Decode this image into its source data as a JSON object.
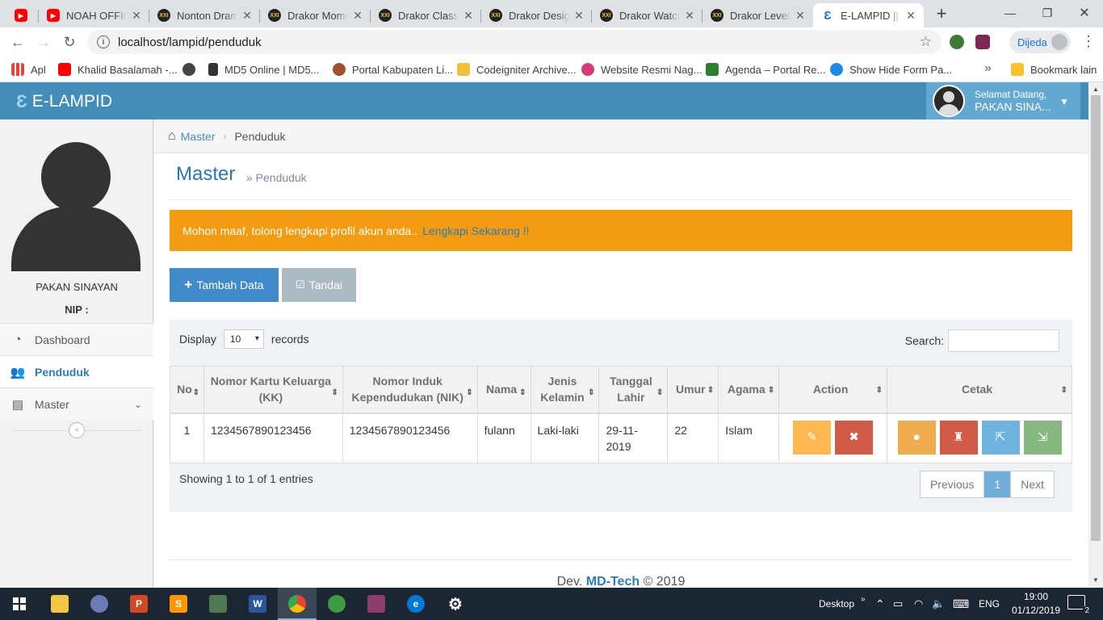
{
  "browser": {
    "tabs": [
      {
        "title": "",
        "icon": "youtube-icon"
      },
      {
        "title": "NOAH OFFICIAL",
        "icon": "youtube-icon"
      },
      {
        "title": "Nonton Drama",
        "icon": "drakor-icon"
      },
      {
        "title": "Drakor Moments",
        "icon": "drakor-icon"
      },
      {
        "title": "Drakor Class of",
        "icon": "drakor-icon"
      },
      {
        "title": "Drakor Design",
        "icon": "drakor-icon"
      },
      {
        "title": "Drakor Watch",
        "icon": "drakor-icon"
      },
      {
        "title": "Drakor Level Up",
        "icon": "drakor-icon"
      },
      {
        "title": "E-LAMPID || Ma",
        "icon": "elampid-icon"
      }
    ],
    "url": "localhost/lampid/penduduk",
    "profile_label": "Dijeda",
    "bookmarks": [
      {
        "label": "Apl"
      },
      {
        "label": "Khalid Basalamah -..."
      },
      {
        "label": ""
      },
      {
        "label": "MD5 Online | MD5..."
      },
      {
        "label": "Portal Kabupaten Li..."
      },
      {
        "label": "Codeigniter Archive..."
      },
      {
        "label": "Website Resmi Nag..."
      },
      {
        "label": "Agenda – Portal Re..."
      },
      {
        "label": "Show Hide Form Pa..."
      }
    ],
    "bookmarks_other": "Bookmark lain"
  },
  "app": {
    "brand": "E-LAMPID",
    "welcome": "Selamat Datang,",
    "user": "PAKAN SINA..."
  },
  "sidebar": {
    "name": "PAKAN SINAYAN",
    "nip": "NIP :",
    "items": [
      {
        "label": "Dashboard"
      },
      {
        "label": "Penduduk"
      },
      {
        "label": "Master"
      }
    ]
  },
  "breadcrumb": {
    "home": "Master",
    "current": "Penduduk"
  },
  "header": {
    "title": "Master",
    "subtitle": "» Penduduk"
  },
  "alert": {
    "text": "Mohon maaf, tolong lengkapi profil akun anda..",
    "link": "Lengkapi Sekarang !!"
  },
  "actions": {
    "add": "Tambah Data",
    "mark": "Tandai"
  },
  "table": {
    "display_label": "Display",
    "display_value": "10",
    "records_label": "records",
    "search_label": "Search:",
    "search_value": "",
    "columns": [
      "No",
      "Nomor Kartu Keluarga (KK)",
      "Nomor Induk Kependudukan (NIK)",
      "Nama",
      "Jenis Kelamin",
      "Tanggal Lahir",
      "Umur",
      "Agama",
      "Action",
      "Cetak"
    ],
    "rows": [
      {
        "no": "1",
        "kk": "1234567890123456",
        "nik": "1234567890123456",
        "nama": "fulann",
        "jk": "Laki-laki",
        "tgl": "29-11-2019",
        "umur": "22",
        "agama": "Islam"
      }
    ],
    "info": "Showing 1 to 1 of 1 entries",
    "prev": "Previous",
    "page": "1",
    "next": "Next"
  },
  "footer": {
    "prefix": "Dev.",
    "brand": "MD-Tech",
    "suffix": "© 2019"
  },
  "taskbar": {
    "desktop": "Desktop",
    "lang": "ENG",
    "time": "19:00",
    "date": "01/12/2019",
    "notifications": "2"
  },
  "colors": {
    "navbar": "#438eb9",
    "alert": "#f39c12",
    "primary": "#428bca",
    "edit": "#ffb752",
    "delete": "#d15b47",
    "print_info": "#6fb3e0",
    "print_success": "#87b87f"
  }
}
